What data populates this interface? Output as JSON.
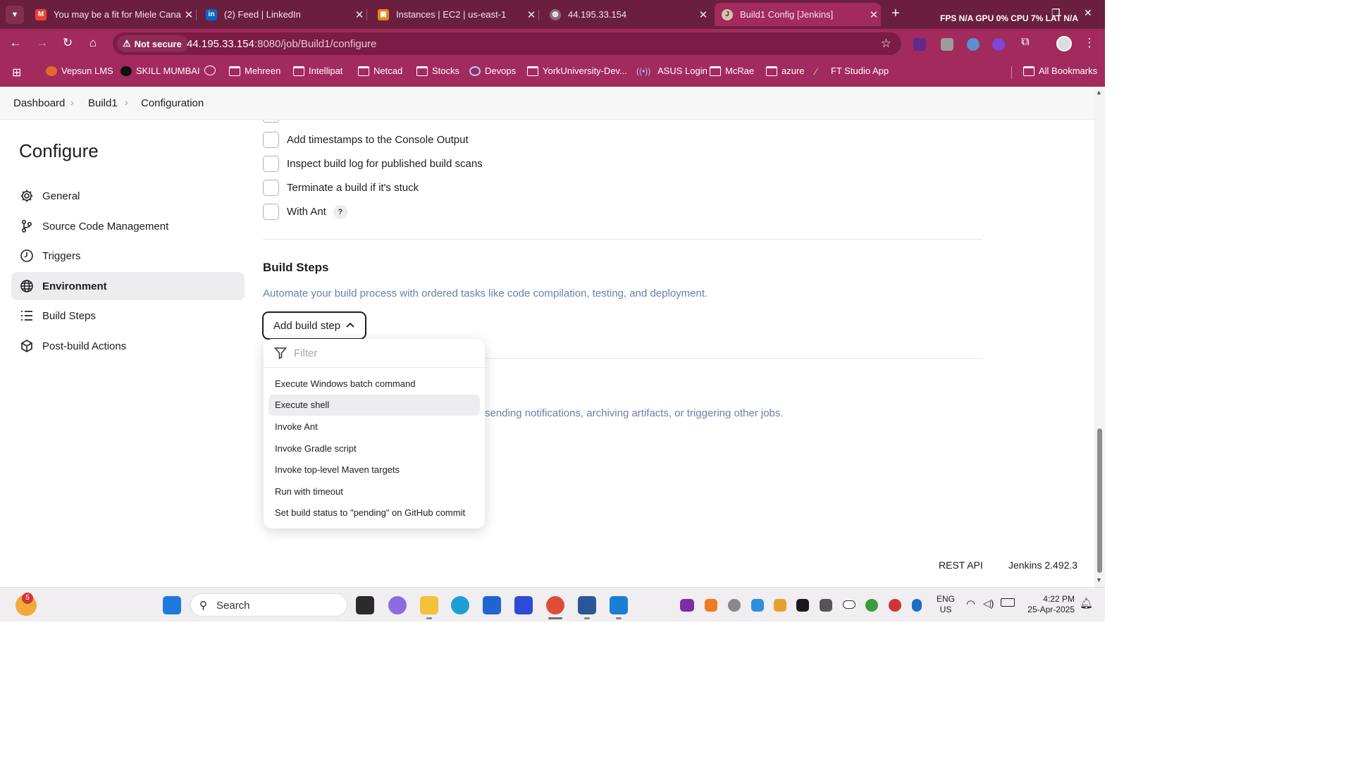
{
  "browser": {
    "tabs": [
      {
        "title": "You may be a fit for Miele Cana",
        "icon": "gmail-icon"
      },
      {
        "title": "(2) Feed | LinkedIn",
        "icon": "linkedin-icon"
      },
      {
        "title": "Instances | EC2 | us-east-1",
        "icon": "aws-icon"
      },
      {
        "title": "44.195.33.154",
        "icon": "globe-icon"
      },
      {
        "title": "Build1 Config [Jenkins]",
        "icon": "jenkins-icon",
        "active": true
      }
    ],
    "perf_overlay": "FPS N/A GPU 0% CPU 7% LAT N/A",
    "security_label": "Not secure",
    "url_host": "44.195.33.154",
    "url_path": ":8080/job/Build1/configure",
    "bookmarks": [
      "Vepsun LMS",
      "SKILL MUMBAI",
      "Mehreen",
      "Intellipat",
      "Netcad",
      "Stocks",
      "Devops",
      "YorkUniversity-Dev...",
      "ASUS Login",
      "McRae",
      "azure",
      "FT Studio App"
    ],
    "all_bookmarks": "All Bookmarks"
  },
  "breadcrumb": [
    "Dashboard",
    "Build1",
    "Configuration"
  ],
  "sidebar": {
    "title": "Configure",
    "items": [
      {
        "label": "General",
        "icon": "gear-icon"
      },
      {
        "label": "Source Code Management",
        "icon": "branch-icon"
      },
      {
        "label": "Triggers",
        "icon": "clock-icon"
      },
      {
        "label": "Environment",
        "icon": "globe-icon",
        "active": true
      },
      {
        "label": "Build Steps",
        "icon": "list-icon"
      },
      {
        "label": "Post-build Actions",
        "icon": "box-icon"
      }
    ]
  },
  "environment_options": [
    "Add timestamps to the Console Output",
    "Inspect build log for published build scans",
    "Terminate a build if it's stuck",
    "With Ant"
  ],
  "help_label": "?",
  "build_steps": {
    "title": "Build Steps",
    "description": "Automate your build process with ordered tasks like code compilation, testing, and deployment.",
    "add_button": "Add build step",
    "filter_placeholder": "Filter",
    "menu": [
      "Execute Windows batch command",
      "Execute shell",
      "Invoke Ant",
      "Invoke Gradle script",
      "Invoke top-level Maven targets",
      "Run with timeout",
      "Set build status to \"pending\" on GitHub commit"
    ],
    "hovered_index": 1
  },
  "post_build": {
    "description_tail": "sending notifications, archiving artifacts, or triggering other jobs."
  },
  "footer": {
    "rest_api": "REST API",
    "version": "Jenkins 2.492.3"
  },
  "taskbar": {
    "search_placeholder": "Search",
    "notification_count": "5",
    "lang_line1": "ENG",
    "lang_line2": "US",
    "time": "4:22 PM",
    "date": "25-Apr-2025"
  },
  "colors": {
    "browser_frame": "#6b1f3f",
    "toolbar": "#a32a5c",
    "sidebar_active": "#ededf0",
    "description_text": "#6a7fa8"
  }
}
